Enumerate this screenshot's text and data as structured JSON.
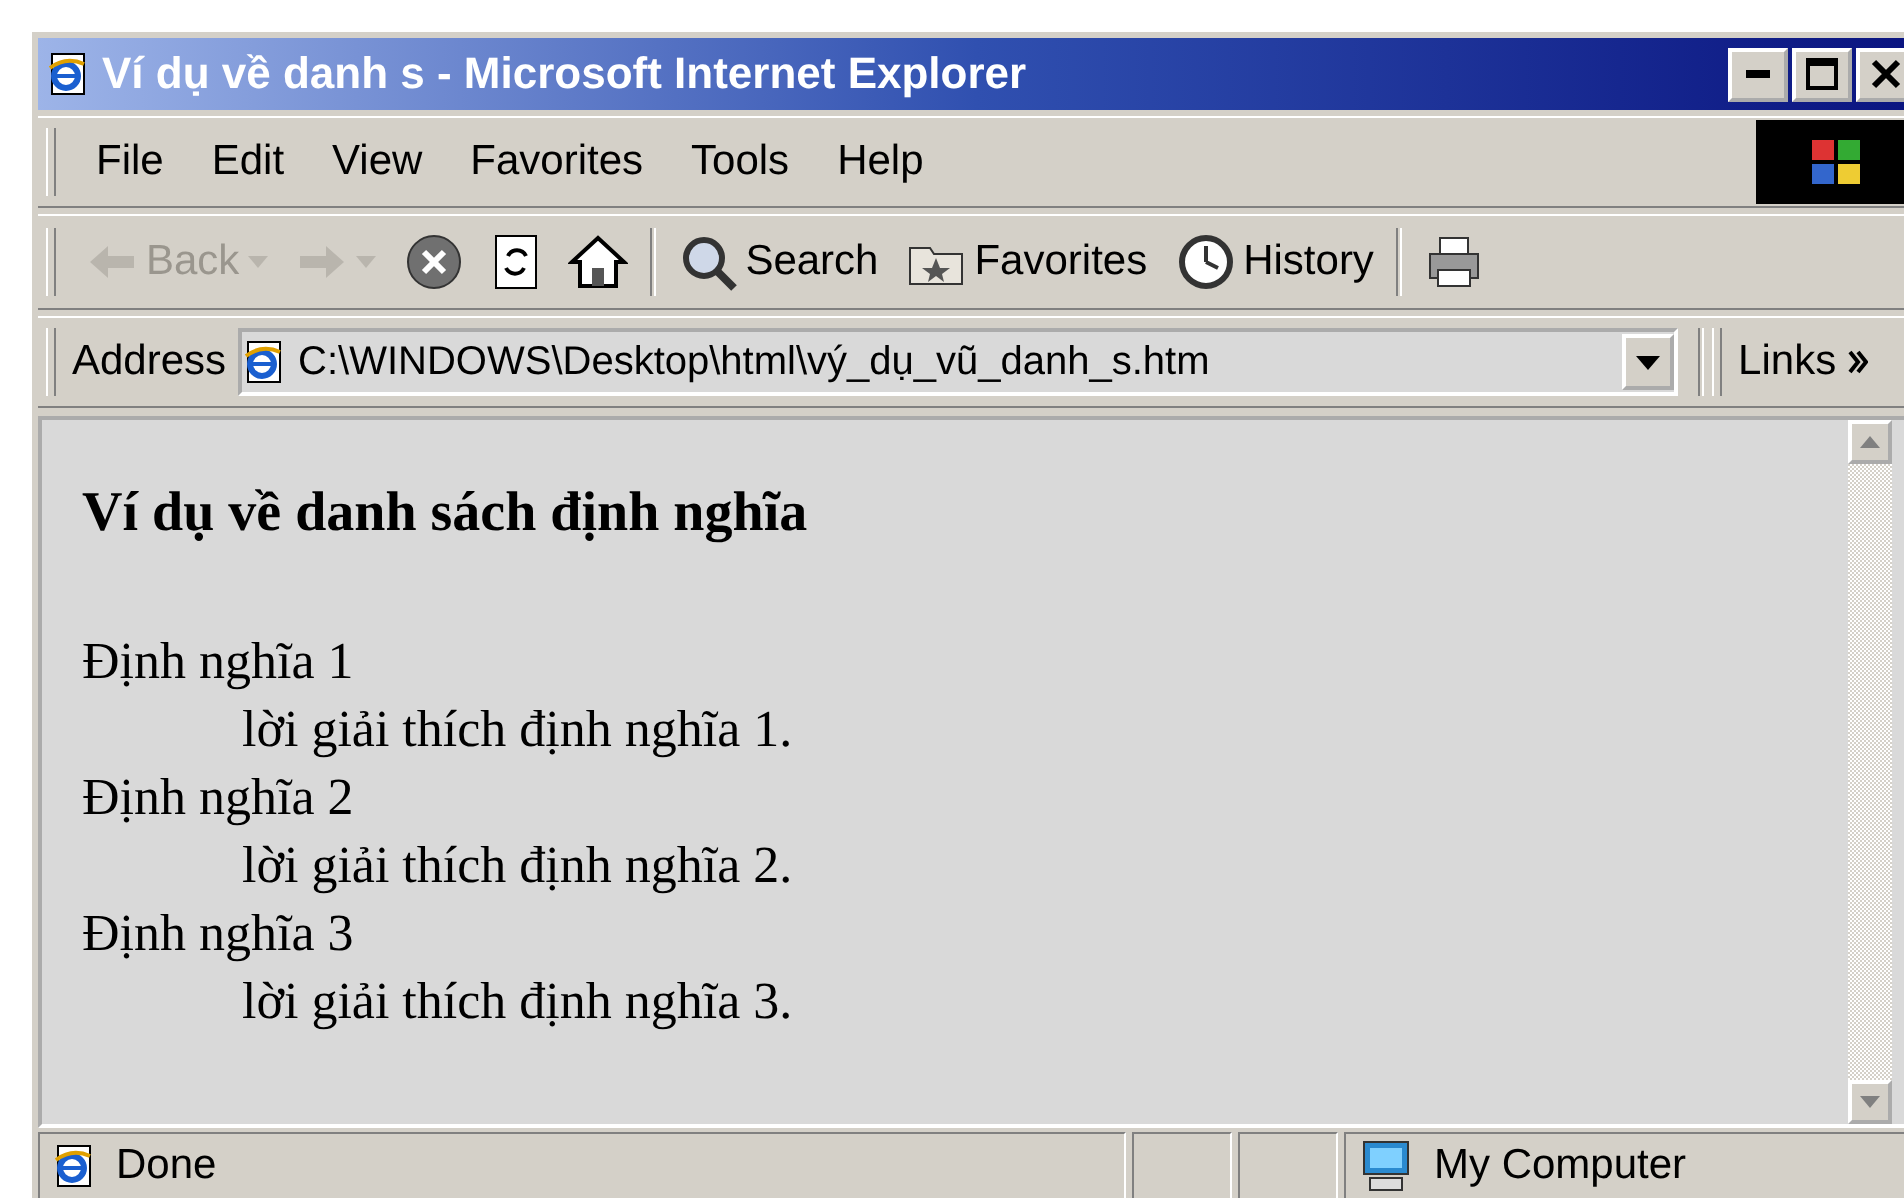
{
  "window": {
    "title": "Ví dụ về danh s - Microsoft Internet Explorer"
  },
  "menu": [
    "File",
    "Edit",
    "View",
    "Favorites",
    "Tools",
    "Help"
  ],
  "toolbar": [
    {
      "kind": "back",
      "label": "Back",
      "disabled": true
    },
    {
      "kind": "forward",
      "disabled": true
    },
    {
      "kind": "stop",
      "disabled": false
    },
    {
      "kind": "refresh",
      "disabled": false
    },
    {
      "kind": "home",
      "disabled": false
    },
    {
      "kind": "search",
      "label": "Search",
      "disabled": false
    },
    {
      "kind": "favorites",
      "label": "Favorites",
      "disabled": false
    },
    {
      "kind": "history",
      "label": "History",
      "disabled": false
    },
    {
      "kind": "print",
      "disabled": false
    }
  ],
  "address": {
    "label": "Address",
    "value": "C:\\WINDOWS\\Desktop\\html\\vý_dụ_vũ_danh_s.htm"
  },
  "links": {
    "label": "Links"
  },
  "page": {
    "heading": "Ví dụ về danh sách định nghĩa",
    "definitions": [
      {
        "term": "Định nghĩa 1",
        "description": "lời giải thích định nghĩa 1."
      },
      {
        "term": "Định nghĩa 2",
        "description": "lời giải thích định nghĩa 2."
      },
      {
        "term": "Định nghĩa 3",
        "description": "lời giải thích định nghĩa 3."
      }
    ]
  },
  "status_bar": {
    "text": "Done",
    "zone": "My Computer"
  }
}
